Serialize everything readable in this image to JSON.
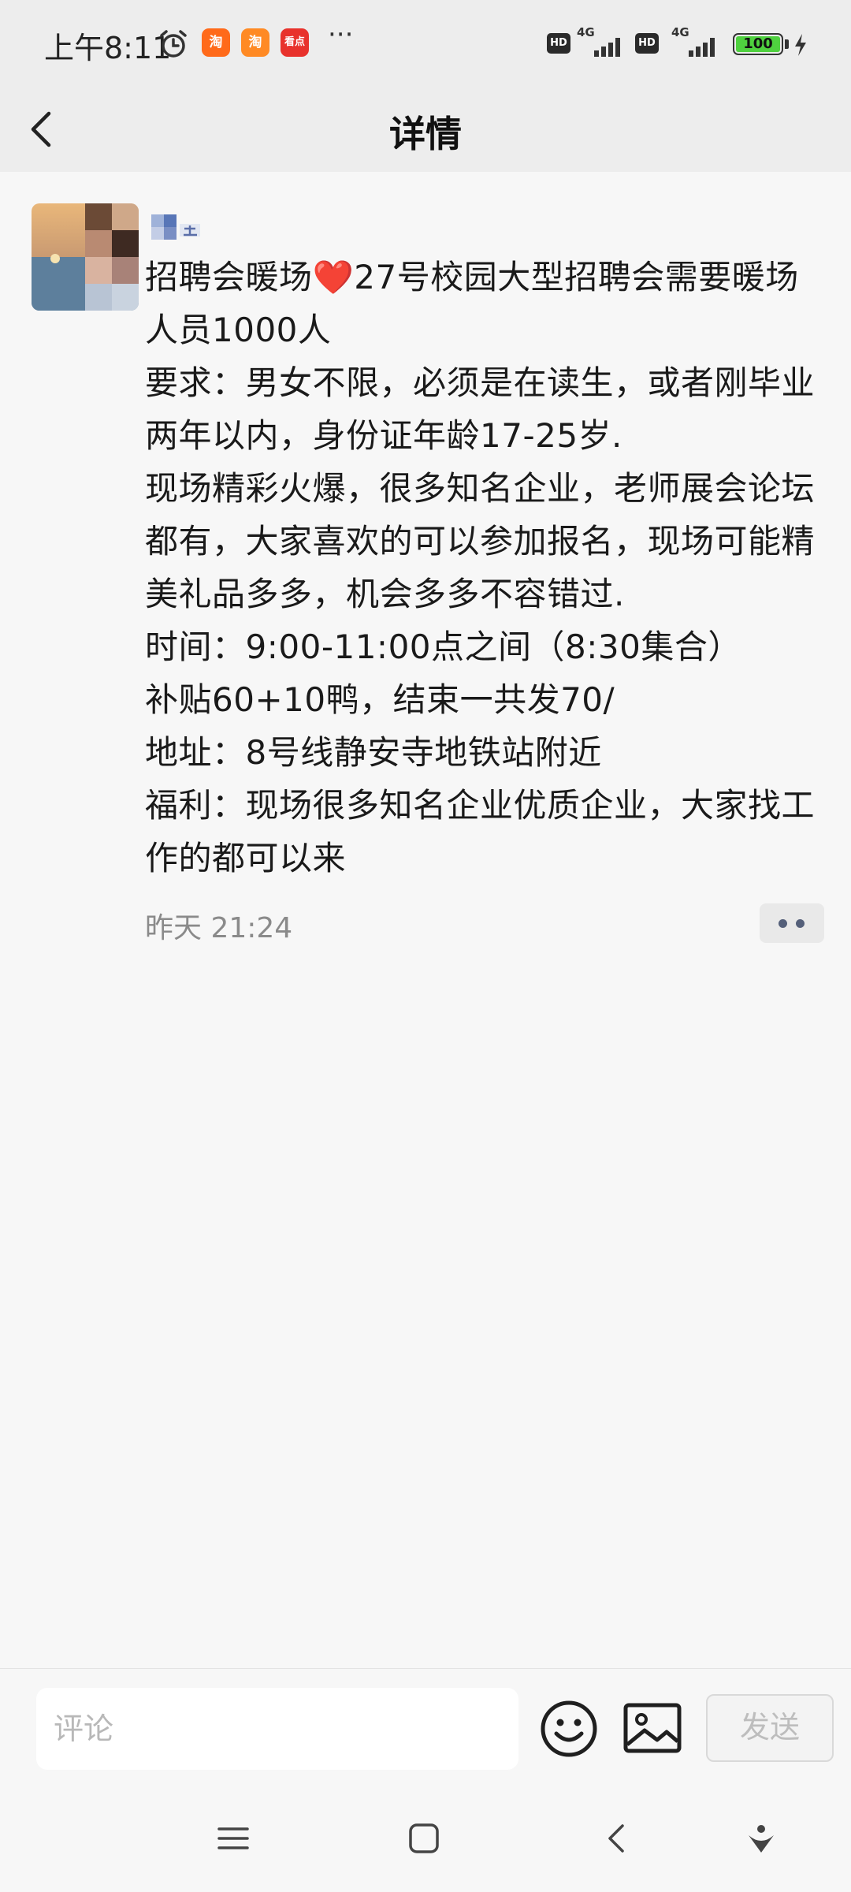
{
  "status_bar": {
    "time": "上午8:11",
    "app_icons": [
      {
        "icon": "taobao-icon",
        "label": "淘"
      },
      {
        "icon": "shopping-icon",
        "label": "淘"
      },
      {
        "icon": "kandian-icon",
        "label": "看点"
      }
    ],
    "more": "···",
    "sim1": {
      "hd": "HD",
      "network": "4G"
    },
    "sim2": {
      "hd": "HD",
      "network": "4G"
    },
    "battery": "100",
    "battery_fraction": 1.0
  },
  "header": {
    "title": "详情",
    "back_icon": "chevron-left-icon"
  },
  "post": {
    "username": "",
    "text": "招聘会暖场❤️27号校园大型招聘会需要暖场人员1000人\n要求：男女不限，必须是在读生，或者刚毕业两年以内，身份证年龄17-25岁.\n现场精彩火爆，很多知名企业，老师展会论坛都有，大家喜欢的可以参加报名，现场可能精美礼品多多，机会多多不容错过.\n时间：9:00-11:00点之间（8:30集合）\n补贴60+10鸭，结束一共发70/\n地址：8号线静安寺地铁站附近\n福利：现场很多知名企业优质企业，大家找工作的都可以来",
    "timestamp": "昨天 21:24"
  },
  "comment_bar": {
    "placeholder": "评论",
    "send_label": "发送"
  },
  "nav_bar": {
    "items": [
      "menu-icon",
      "home-icon",
      "back-icon",
      "assistant-icon"
    ]
  },
  "colors": {
    "header_bg": "#ededed",
    "page_bg": "#f7f7f7",
    "timestamp": "#8a8a8a",
    "more_dots": "#55607a",
    "battery": "#4fd13f"
  }
}
